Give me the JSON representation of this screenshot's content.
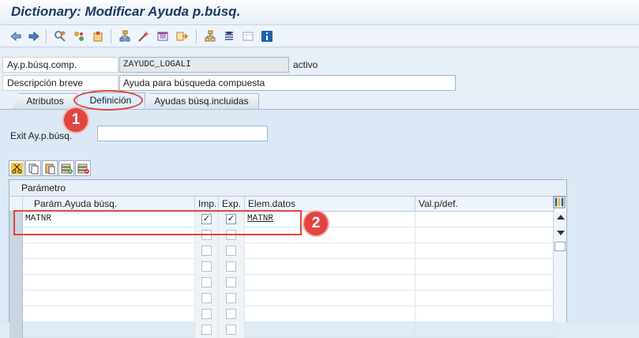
{
  "window": {
    "title": "Dictionary: Modificar Ayuda p.búsq."
  },
  "toolbar": {
    "icons": [
      "back-icon",
      "forward-icon",
      "other-object-icon",
      "display-change-icon",
      "activate-icon",
      "where-used-icon",
      "navigate-icon",
      "hierarchy-icon",
      "enhancement-icon",
      "object-list-icon",
      "documentation-icon",
      "info-icon"
    ]
  },
  "header": {
    "comp_label": "Ay.p.búsq.comp.",
    "comp_value": "ZAYUDC_LOGALI",
    "status": "activo",
    "desc_label": "Descripción breve",
    "desc_value": "Ayuda para búsqueda compuesta"
  },
  "tabs": [
    {
      "label": "Atributos"
    },
    {
      "label": "Definición"
    },
    {
      "label": "Ayudas búsq.incluidas"
    }
  ],
  "definition": {
    "exit_label": "Exit Ay.p.búsq.",
    "exit_value": ""
  },
  "grid": {
    "title": "Parámetro",
    "columns": [
      "Parám.Ayuda búsq.",
      "Imp.",
      "Exp.",
      "Elem.datos",
      "Val.p/def."
    ],
    "rows": [
      {
        "param": "MATNR",
        "imp": true,
        "exp": true,
        "elem": "MATNR",
        "def": ""
      },
      {
        "param": "",
        "imp": false,
        "exp": false,
        "elem": "",
        "def": ""
      },
      {
        "param": "",
        "imp": false,
        "exp": false,
        "elem": "",
        "def": ""
      },
      {
        "param": "",
        "imp": false,
        "exp": false,
        "elem": "",
        "def": ""
      },
      {
        "param": "",
        "imp": false,
        "exp": false,
        "elem": "",
        "def": ""
      },
      {
        "param": "",
        "imp": false,
        "exp": false,
        "elem": "",
        "def": ""
      },
      {
        "param": "",
        "imp": false,
        "exp": false,
        "elem": "",
        "def": ""
      },
      {
        "param": "",
        "imp": false,
        "exp": false,
        "elem": "",
        "def": ""
      }
    ]
  },
  "annotations": {
    "badge1": "1",
    "badge2": "2",
    "color": "#e0453f"
  },
  "check_mark": "✓"
}
